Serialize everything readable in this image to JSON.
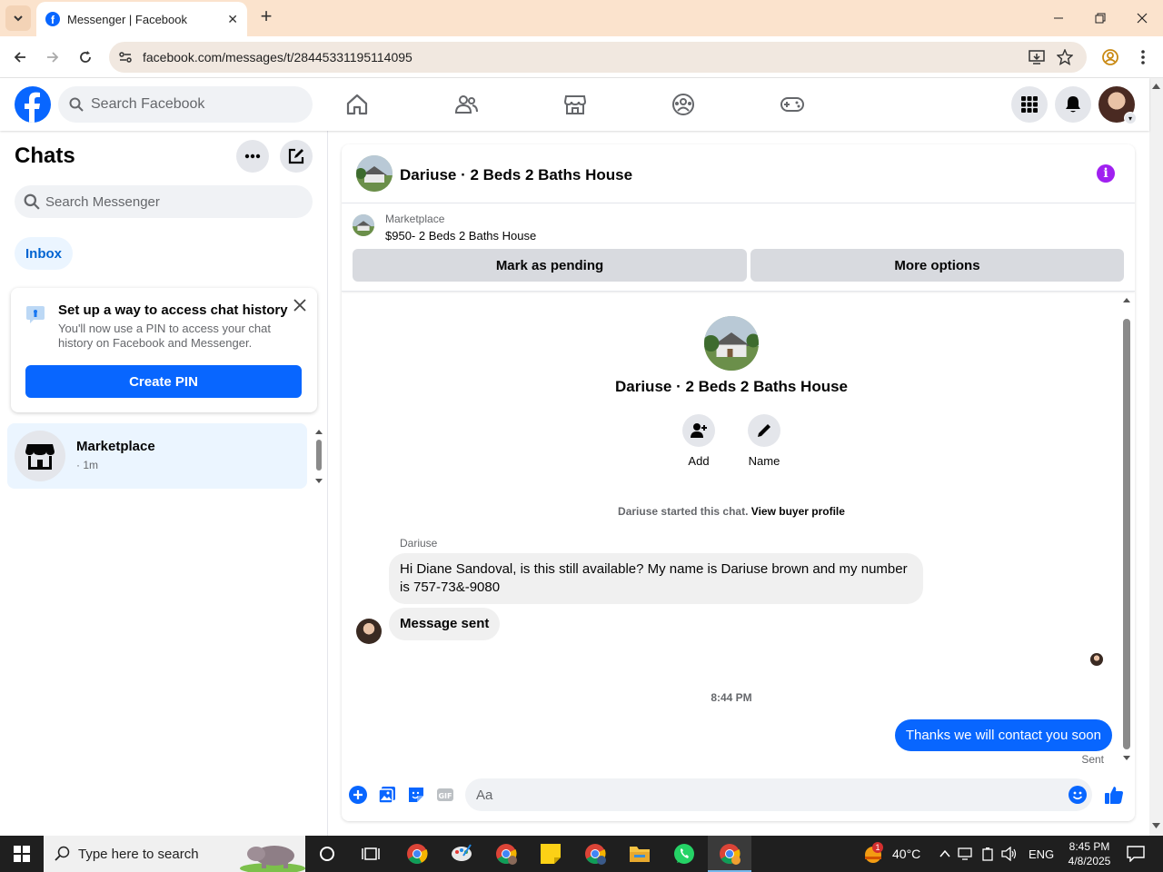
{
  "browser": {
    "tab_title": "Messenger | Facebook",
    "url": "facebook.com/messages/t/28445331195114095"
  },
  "topnav": {
    "search_placeholder": "Search Facebook"
  },
  "sidebar": {
    "title": "Chats",
    "search_placeholder": "Search Messenger",
    "filter_tab": "Inbox",
    "pin_card": {
      "title": "Set up a way to access chat history",
      "description": "You'll now use a PIN to access your chat history on Facebook and Messenger.",
      "button": "Create PIN"
    },
    "chats": [
      {
        "name": "Marketplace",
        "time": "· 1m"
      }
    ]
  },
  "conversation": {
    "title": "Dariuse · 2 Beds 2 Baths House",
    "marketplace_label": "Marketplace",
    "listing": "$950- 2 Beds 2 Baths House",
    "mark_pending": "Mark as pending",
    "more_options": "More options",
    "profile_name": "Dariuse · 2 Beds 2 Baths House",
    "actions": {
      "add": "Add",
      "name": "Name"
    },
    "started_text": "Dariuse started this chat.",
    "buyer_profile_link": "View buyer profile",
    "messages": [
      {
        "sender": "Dariuse",
        "text": "Hi Diane Sandoval, is this still available? My name is Dariuse brown and my number is 757-73&-9080"
      },
      {
        "text": "Message sent"
      }
    ],
    "timestamp": "8:44 PM",
    "outgoing": {
      "text": "Thanks we will contact you soon",
      "status": "Sent"
    },
    "composer_placeholder": "Aa"
  },
  "taskbar": {
    "search_placeholder": "Type here to search",
    "weather": "40°C",
    "weather_badge": "1",
    "language": "ENG",
    "time": "8:45 PM",
    "date": "4/8/2025"
  },
  "colors": {
    "accent": "#0866ff",
    "chrome_tabstrip": "#fbe3cd",
    "info": "#a020f0"
  }
}
